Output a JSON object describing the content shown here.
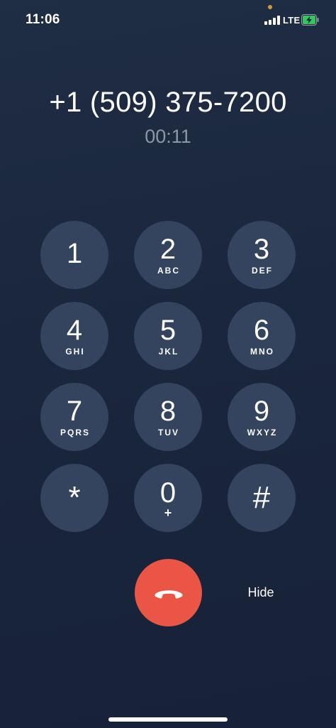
{
  "status_bar": {
    "time": "11:06",
    "network": "LTE",
    "icons": [
      "signal-icon",
      "battery-charging-icon"
    ],
    "battery_color": "#34c759"
  },
  "call": {
    "number": "+1 (509) 375-7200",
    "timer": "00:11"
  },
  "keypad": {
    "keys": [
      {
        "digit": "1",
        "letters": ""
      },
      {
        "digit": "2",
        "letters": "ABC"
      },
      {
        "digit": "3",
        "letters": "DEF"
      },
      {
        "digit": "4",
        "letters": "GHI"
      },
      {
        "digit": "5",
        "letters": "JKL"
      },
      {
        "digit": "6",
        "letters": "MNO"
      },
      {
        "digit": "7",
        "letters": "PQRS"
      },
      {
        "digit": "8",
        "letters": "TUV"
      },
      {
        "digit": "9",
        "letters": "WXYZ"
      },
      {
        "digit": "*",
        "letters": ""
      },
      {
        "digit": "0",
        "letters": "+"
      },
      {
        "digit": "#",
        "letters": ""
      }
    ]
  },
  "controls": {
    "end_call_icon": "end-call-icon",
    "end_call_color": "#eb5545",
    "hide_label": "Hide"
  }
}
